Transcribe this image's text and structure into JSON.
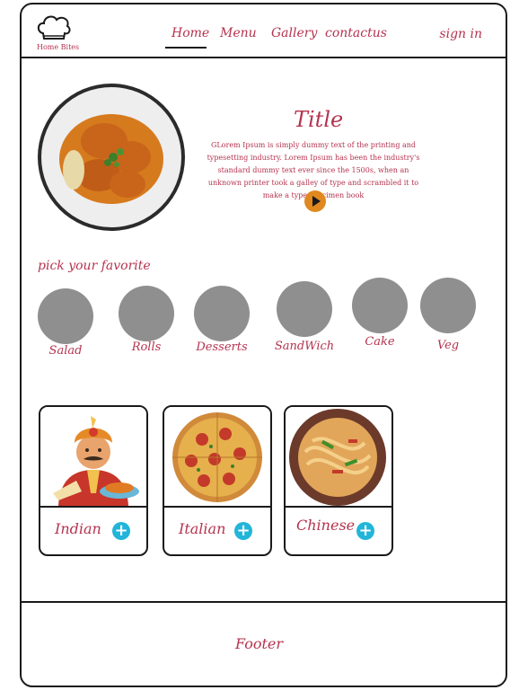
{
  "brand": {
    "logo_text": "Home Bites"
  },
  "nav": {
    "links": [
      "Home",
      "Menu",
      "Gallery",
      "contactus"
    ],
    "sign_in": "sign in"
  },
  "hero": {
    "title": "Title",
    "description": "GLorem Ipsum is simply dummy text of the printing and typesetting industry. Lorem Ipsum has been the industry's standard dummy text ever since the 1500s, when an unknown printer took a galley of type and scrambled it to make a type specimen book"
  },
  "favorites": {
    "title": "pick your favorite",
    "categories": [
      "Salad",
      "Rolls",
      "Desserts",
      "SandWich",
      "Cake",
      "Veg"
    ]
  },
  "cuisines": {
    "cards": [
      {
        "label": "Indian",
        "image": "indian-chef-illustration"
      },
      {
        "label": "Italian",
        "image": "pizza-illustration"
      },
      {
        "label": "Chinese",
        "image": "noodles-illustration"
      }
    ],
    "add_icon": "plus-icon"
  },
  "footer": {
    "text": "Footer"
  },
  "colors": {
    "accent": "#b5334f",
    "play": "#e0891f",
    "add": "#22b5d9",
    "placeholder": "#8f8f8f"
  }
}
